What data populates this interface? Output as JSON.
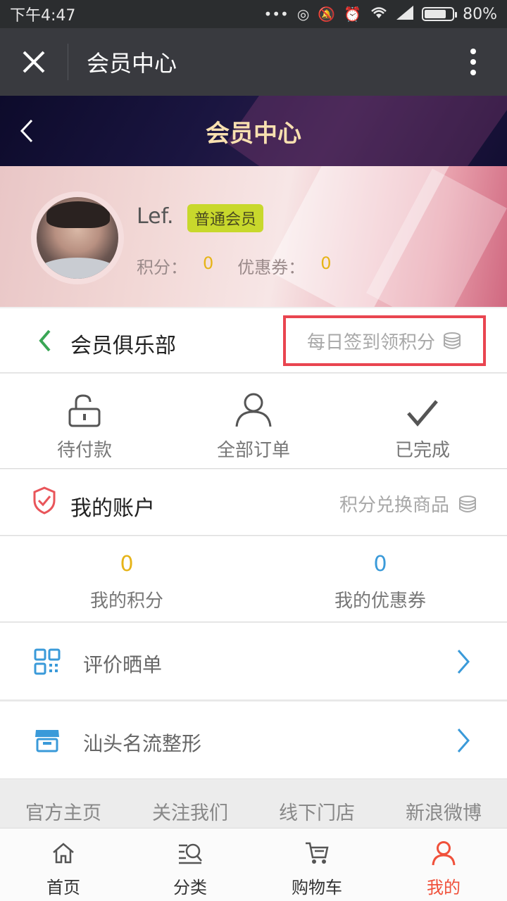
{
  "status_bar": {
    "time": "下午4:47",
    "battery": "80%",
    "battery_level": 0.8
  },
  "wechat_bar": {
    "title": "会员中心"
  },
  "page_header": {
    "title": "会员中心"
  },
  "profile": {
    "username": "Lef.",
    "member_level": "普通会员",
    "points_label": "积分：",
    "points_value": "0",
    "coupons_label": "优惠券：",
    "coupons_value": "0"
  },
  "club": {
    "title": "会员俱乐部",
    "signin_label": "每日签到领积分"
  },
  "orders": [
    {
      "label": "待付款"
    },
    {
      "label": "全部订单"
    },
    {
      "label": "已完成"
    }
  ],
  "account": {
    "title": "我的账户",
    "exchange_label": "积分兑换商品"
  },
  "balances": [
    {
      "value": "0",
      "label": "我的积分",
      "color": "#e6b418"
    },
    {
      "value": "0",
      "label": "我的优惠券",
      "color": "#3a9ad9"
    }
  ],
  "menu": [
    {
      "label": "评价晒单",
      "icon": "qr-grid-icon"
    },
    {
      "label": "汕头名流整形",
      "icon": "store-icon"
    }
  ],
  "footer_links": [
    "官方主页",
    "关注我们",
    "线下门店",
    "新浪微博"
  ],
  "tabs": [
    {
      "label": "首页",
      "icon": "home-icon"
    },
    {
      "label": "分类",
      "icon": "category-search-icon"
    },
    {
      "label": "购物车",
      "icon": "cart-icon"
    },
    {
      "label": "我的",
      "icon": "user-icon",
      "active": true
    }
  ],
  "colors": {
    "accent_active": "#f0503a",
    "highlight_border": "#e94550",
    "green": "#3aa655",
    "blue": "#3a9ad9"
  }
}
